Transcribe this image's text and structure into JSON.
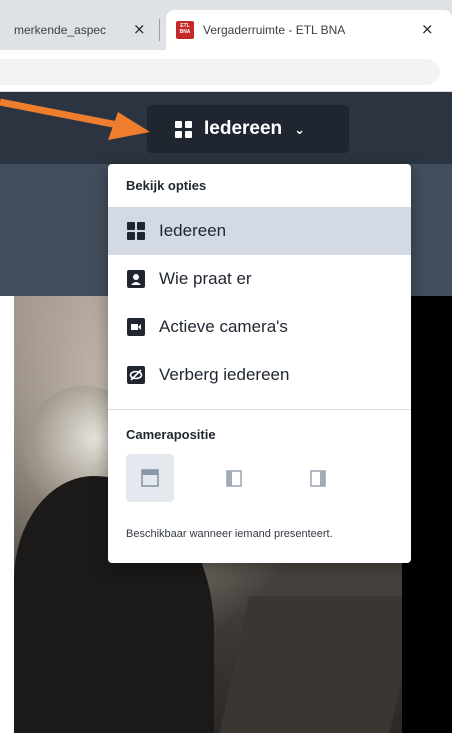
{
  "browser": {
    "tabs": [
      {
        "title": "merkende_aspec",
        "close": "×"
      },
      {
        "title": "Vergaderruimte - ETL BNA",
        "close": "×",
        "favicon_text": "ETL BNA"
      }
    ]
  },
  "header": {
    "view_button_label": "Iedereen",
    "view_button_icon": "grid-icon",
    "chevron": "⌄"
  },
  "menu": {
    "view_heading": "Bekijk opties",
    "items": [
      {
        "label": "Iedereen",
        "icon": "grid-icon",
        "selected": true
      },
      {
        "label": "Wie praat er",
        "icon": "speaker-icon",
        "selected": false
      },
      {
        "label": "Actieve camera's",
        "icon": "camera-icon",
        "selected": false
      },
      {
        "label": "Verberg iedereen",
        "icon": "eye-off-icon",
        "selected": false
      }
    ],
    "camera_heading": "Camerapositie",
    "camera_positions": [
      "camera-top-icon",
      "camera-left-icon",
      "camera-right-icon"
    ],
    "camera_note": "Beschikbaar wanneer iemand presenteert."
  },
  "colors": {
    "annotation_arrow": "#ee7d2e",
    "header_bg": "#2b3440",
    "selected_item_bg": "#d3dae3"
  }
}
